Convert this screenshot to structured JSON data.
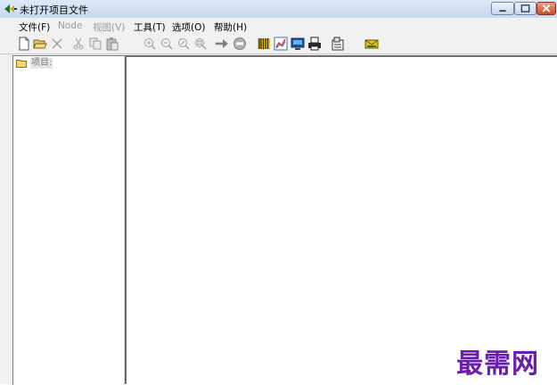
{
  "window": {
    "title": "未打开项目文件"
  },
  "menu": {
    "items": [
      {
        "label": "文件(F)",
        "enabled": true
      },
      {
        "label": "Node",
        "enabled": false
      },
      {
        "label": "视图(V)",
        "enabled": false
      },
      {
        "label": "工具(T)",
        "enabled": true
      },
      {
        "label": "选项(O)",
        "enabled": true
      },
      {
        "label": "帮助(H)",
        "enabled": true
      }
    ]
  },
  "toolbar": {
    "buttons": [
      {
        "icon": "new-file-icon",
        "enabled": true
      },
      {
        "icon": "open-folder-icon",
        "enabled": true
      },
      {
        "icon": "delete-icon",
        "enabled": false
      },
      {
        "icon": "cut-icon",
        "enabled": false
      },
      {
        "icon": "copy-icon",
        "enabled": false
      },
      {
        "icon": "paste-icon",
        "enabled": false
      },
      {
        "icon": "zoom-in-icon",
        "enabled": false
      },
      {
        "icon": "zoom-out-icon",
        "enabled": false
      },
      {
        "icon": "zoom-area-icon",
        "enabled": false
      },
      {
        "icon": "zoom-fit-icon",
        "enabled": false
      },
      {
        "icon": "go-arrow-icon",
        "enabled": false
      },
      {
        "icon": "stop-icon",
        "enabled": false
      },
      {
        "icon": "barcode-icon",
        "enabled": true
      },
      {
        "icon": "chart-icon",
        "enabled": true
      },
      {
        "icon": "monitor-icon",
        "enabled": true
      },
      {
        "icon": "print-icon",
        "enabled": true
      },
      {
        "icon": "properties-icon",
        "enabled": true
      },
      {
        "icon": "mail-icon",
        "enabled": true
      }
    ]
  },
  "tree": {
    "root_label": "项目:"
  },
  "watermark": "最需网",
  "colors": {
    "title_bar": "#c6d9ef",
    "close_button": "#c84a28",
    "watermark": "#6a1fa8",
    "folder": "#f5d76e"
  }
}
